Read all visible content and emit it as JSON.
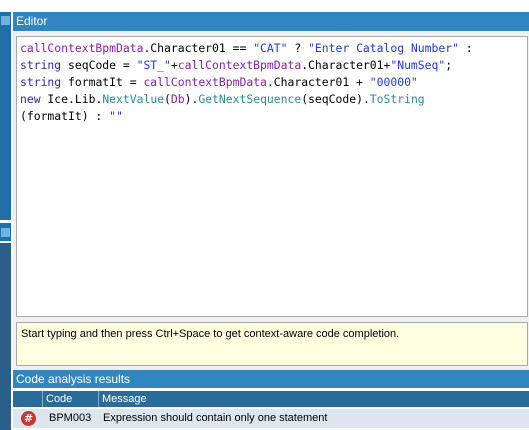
{
  "editor": {
    "title": "Editor",
    "code_lines": [
      [
        {
          "t": "callContextBpmData",
          "c": "purple"
        },
        {
          "t": ".Character01 == ",
          "c": "black"
        },
        {
          "t": "\"CAT\"",
          "c": "blue"
        },
        {
          "t": " ? ",
          "c": "black"
        },
        {
          "t": "\"Enter Catalog Number\"",
          "c": "blue"
        },
        {
          "t": " :",
          "c": "black"
        }
      ],
      [
        {
          "t": "string",
          "c": "darkblue"
        },
        {
          "t": " seqCode = ",
          "c": "black"
        },
        {
          "t": "\"ST_\"",
          "c": "blue"
        },
        {
          "t": "+",
          "c": "black"
        },
        {
          "t": "callContextBpmData",
          "c": "purple"
        },
        {
          "t": ".Character01+",
          "c": "black"
        },
        {
          "t": "\"NumSeq\"",
          "c": "blue"
        },
        {
          "t": ";",
          "c": "black"
        }
      ],
      [
        {
          "t": "string",
          "c": "darkblue"
        },
        {
          "t": " formatIt = ",
          "c": "black"
        },
        {
          "t": "callContextBpmData",
          "c": "purple"
        },
        {
          "t": ".Character01 + ",
          "c": "black"
        },
        {
          "t": "\"00000\"",
          "c": "blue"
        }
      ],
      [
        {
          "t": "new",
          "c": "darkblue"
        },
        {
          "t": " Ice.Lib.",
          "c": "black"
        },
        {
          "t": "NextValue",
          "c": "teal"
        },
        {
          "t": "(",
          "c": "black"
        },
        {
          "t": "Db",
          "c": "purple"
        },
        {
          "t": ").",
          "c": "black"
        },
        {
          "t": "GetNextSequence",
          "c": "teal"
        },
        {
          "t": "(seqCode).",
          "c": "black"
        },
        {
          "t": "ToString",
          "c": "teal"
        }
      ],
      [
        {
          "t": "(formatIt) : ",
          "c": "black"
        },
        {
          "t": "\"\"",
          "c": "blue"
        }
      ]
    ]
  },
  "hint": {
    "text": "Start typing and then press Ctrl+Space to get context-aware code completion."
  },
  "results": {
    "title": "Code analysis results",
    "columns": [
      "",
      "Code",
      "Message"
    ],
    "rows": [
      {
        "icon": "error-icon",
        "icon_glyph": "#",
        "code": "BPM003",
        "message": "Expression should contain only one statement"
      }
    ]
  },
  "colors": {
    "header_blue": "#2f86c0",
    "code_purple": "#8b1fa9",
    "code_string": "#1c3bd6",
    "code_keyword": "#2a2aa8",
    "code_method": "#2b8a9a",
    "error_red": "#c8372d",
    "hint_bg": "#ffffe1"
  }
}
